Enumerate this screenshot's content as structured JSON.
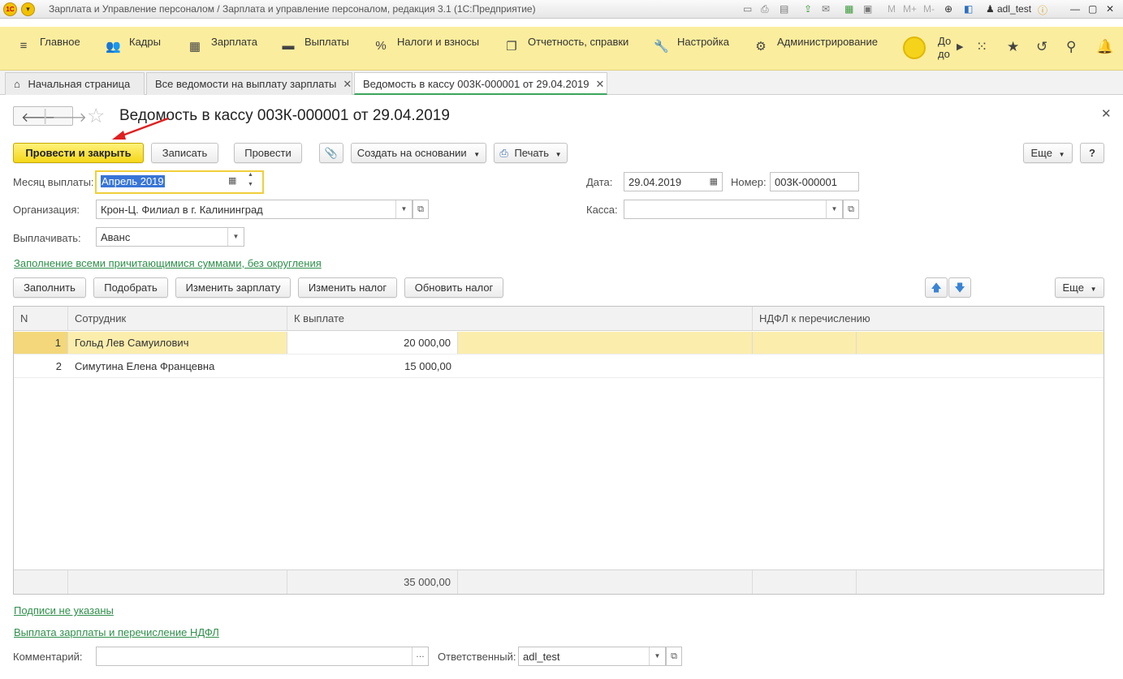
{
  "window": {
    "title": "Зарплата и Управление персоналом / Зарплата и управление персоналом, редакция 3.1  (1С:Предприятие)",
    "logo": "1С",
    "user": "adl_test",
    "toolbar_icons": [
      "save-icon",
      "print-icon",
      "preview-icon",
      "upload-icon",
      "mail-icon",
      "calculator-icon",
      "calendar-icon",
      "memory-icon",
      "zoom-icon",
      "window-icon",
      "user-icon",
      "info-icon"
    ],
    "mem_labels": [
      "M",
      "M+",
      "M-"
    ]
  },
  "sections": {
    "items": [
      {
        "label": "Главное",
        "icon": "hamburger-icon"
      },
      {
        "label": "Кадры",
        "icon": "people-icon"
      },
      {
        "label": "Зарплата",
        "icon": "calculator-icon"
      },
      {
        "label": "Выплаты",
        "icon": "wallet-icon"
      },
      {
        "label": "Налоги и взносы",
        "icon": "percent-icon"
      },
      {
        "label": "Отчетность, справки",
        "icon": "reports-icon"
      },
      {
        "label": "Настройка",
        "icon": "wrench-icon"
      },
      {
        "label": "Администрирование",
        "icon": "gear-icon"
      }
    ],
    "more_text": "До\nдо"
  },
  "tabs": [
    {
      "label": "Начальная страница"
    },
    {
      "label": "Все ведомости на выплату зарплаты"
    },
    {
      "label": "Ведомость в кассу 003К-000001 от 29.04.2019"
    }
  ],
  "document": {
    "title": "Ведомость в кассу 003К-000001 от 29.04.2019",
    "buttons": {
      "post_close": "Провести и закрыть",
      "save": "Записать",
      "post": "Провести",
      "create_based": "Создать на основании",
      "print": "Печать",
      "more": "Еще",
      "help": "?"
    },
    "fields": {
      "month_label": "Месяц выплаты:",
      "month_value": "Апрель 2019",
      "date_label": "Дата:",
      "date_value": "29.04.2019",
      "number_label": "Номер:",
      "number_value": "003К-000001",
      "org_label": "Организация:",
      "org_value": "Крон-Ц. Филиал в г. Калининград",
      "cash_label": "Касса:",
      "cash_value": "",
      "pay_label": "Выплачивать:",
      "pay_value": "Аванс"
    },
    "fill_link": "Заполнение всеми причитающимися суммами, без округления",
    "table_buttons": {
      "fill": "Заполнить",
      "pick": "Подобрать",
      "change_salary": "Изменить зарплату",
      "change_tax": "Изменить налог",
      "refresh_tax": "Обновить налог",
      "more": "Еще"
    },
    "table": {
      "headers": [
        "N",
        "Сотрудник",
        "К выплате",
        "НДФЛ к перечислению"
      ],
      "rows": [
        {
          "n": "1",
          "employee": "Гольд Лев Самуилович",
          "amount": "20 000,00"
        },
        {
          "n": "2",
          "employee": "Симутина Елена Францевна",
          "amount": "15 000,00"
        }
      ],
      "total": "35 000,00"
    },
    "signatures_link": "Подписи не указаны",
    "payment_link": "Выплата зарплаты и перечисление НДФЛ",
    "comment_label": "Комментарий:",
    "comment_value": "",
    "responsible_label": "Ответственный:",
    "responsible_value": "adl_test"
  },
  "colors": {
    "sections_bg": "#fbed9e",
    "primary_button": "#f5d71a",
    "selected_row": "#fbedac",
    "link": "#2f8f4b",
    "annotation_arrow": "#e02020"
  }
}
